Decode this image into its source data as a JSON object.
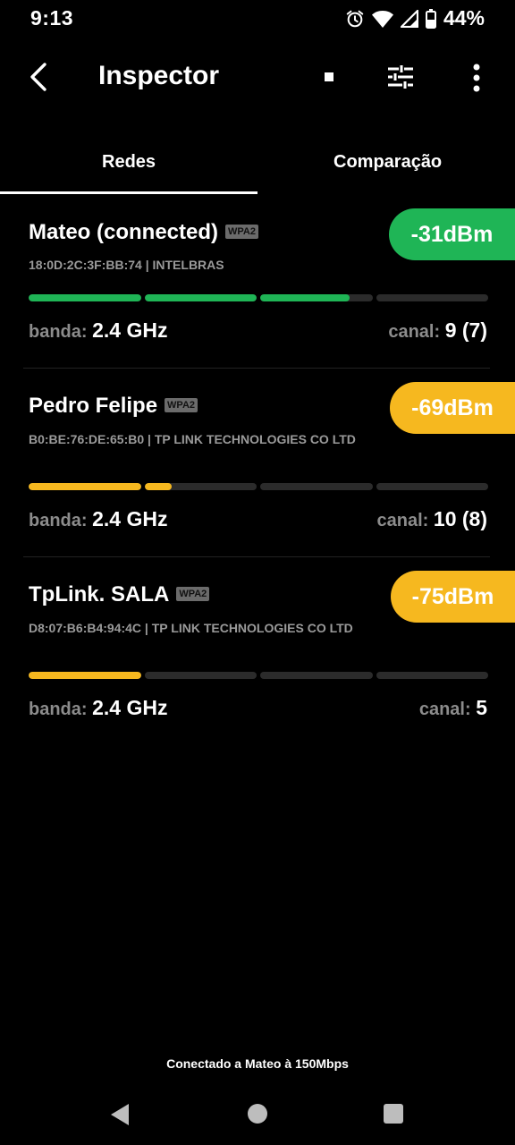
{
  "status": {
    "time": "9:13",
    "battery": "44%"
  },
  "appbar": {
    "title": "Inspector"
  },
  "tabs": [
    {
      "label": "Redes",
      "selected": true
    },
    {
      "label": "Comparação",
      "selected": false
    }
  ],
  "networks": [
    {
      "name": "Mateo (connected)",
      "security": "WPA2",
      "mac": "18:0D:2C:3F:BB:74  | INTELBRAS",
      "signal": "-31dBm",
      "signal_color": "#1fb556",
      "signal_level": 0.7,
      "band_label": "banda:",
      "band_value": "2.4 GHz",
      "channel_label": "canal:",
      "channel_value": "9 (7)"
    },
    {
      "name": "Pedro Felipe",
      "security": "WPA2",
      "mac": "B0:BE:76:DE:65:B0  | TP LINK TECHNOLOGIES CO LTD",
      "signal": "-69dBm",
      "signal_color": "#f6b81f",
      "signal_level": 0.31,
      "band_label": "banda:",
      "band_value": "2.4 GHz",
      "channel_label": "canal:",
      "channel_value": "10 (8)"
    },
    {
      "name": "TpLink. SALA",
      "security": "WPA2",
      "mac": "D8:07:B6:B4:94:4C  | TP LINK TECHNOLOGIES CO LTD",
      "signal": "-75dBm",
      "signal_color": "#f6b81f",
      "signal_level": 0.25,
      "band_label": "banda:",
      "band_value": "2.4 GHz",
      "channel_label": "canal:",
      "channel_value": "5"
    }
  ],
  "footer": {
    "text": "Conectado a  Mateo  à  150Mbps"
  },
  "icons": {
    "back": "arrow-back-icon",
    "stop": "stop-icon",
    "tune": "tune-icon",
    "more": "more-vert-icon",
    "alarm": "alarm-icon",
    "wifi": "wifi-icon",
    "cell": "cell-signal-icon",
    "battery": "battery-icon"
  }
}
